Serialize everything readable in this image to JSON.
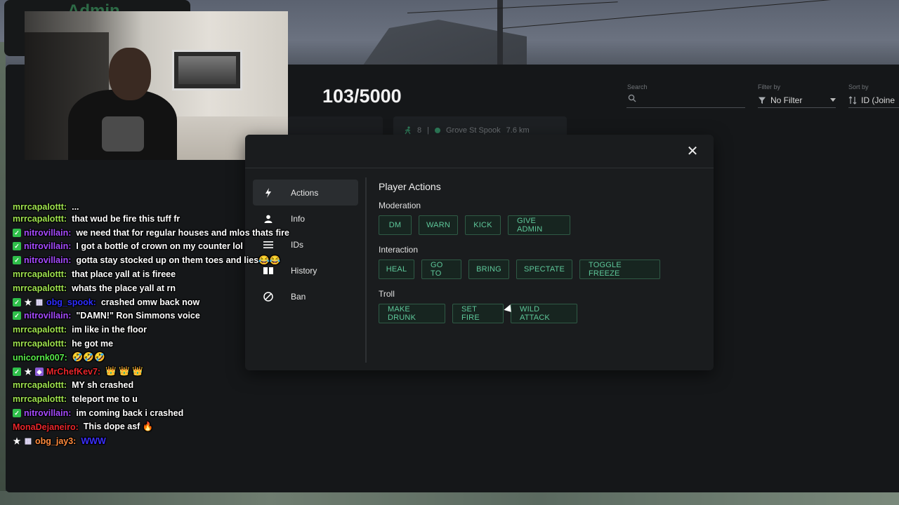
{
  "admin_tab": {
    "title": "Admin"
  },
  "header": {
    "player_count": "103/5000"
  },
  "filters": {
    "search_label": "Search",
    "search_placeholder": "",
    "filter_label": "Filter by",
    "filter_value": "No Filter",
    "sort_label": "Sort by",
    "sort_value": "ID (Joine"
  },
  "player_card": {
    "id": "8",
    "name": "Grove St Spook",
    "distance": "7.6 km"
  },
  "modal": {
    "close_label": "✕",
    "sidebar": [
      {
        "label": "Actions",
        "icon": "lightning-icon",
        "active": true
      },
      {
        "label": "Info",
        "icon": "person-icon"
      },
      {
        "label": "IDs",
        "icon": "list-icon"
      },
      {
        "label": "History",
        "icon": "book-icon"
      },
      {
        "label": "Ban",
        "icon": "ban-icon"
      }
    ],
    "title": "Player Actions",
    "sections": [
      {
        "label": "Moderation",
        "buttons": [
          "DM",
          "WARN",
          "KICK",
          "GIVE ADMIN"
        ]
      },
      {
        "label": "Interaction",
        "buttons": [
          "HEAL",
          "GO TO",
          "BRING",
          "SPECTATE",
          "TOGGLE FREEZE"
        ]
      },
      {
        "label": "Troll",
        "buttons": [
          "MAKE DRUNK",
          "SET FIRE",
          "WILD ATTACK"
        ]
      }
    ]
  },
  "chat": [
    {
      "user": "mrrcapalottt:",
      "color": "#9fe34f",
      "badges": [],
      "text": "..."
    },
    {
      "user": "mrrcapalottt:",
      "color": "#9fe34f",
      "badges": [],
      "text": "that wud be fire this tuff fr"
    },
    {
      "user": "nitrovillain:",
      "color": "#a64bff",
      "badges": [
        "check"
      ],
      "text": "we need that for regular houses and mlos thats fire"
    },
    {
      "user": "nitrovillain:",
      "color": "#a64bff",
      "badges": [
        "check"
      ],
      "text": "I got a bottle of crown on my counter lol"
    },
    {
      "user": "nitrovillain:",
      "color": "#a64bff",
      "badges": [
        "check"
      ],
      "text": "gotta stay stocked up on them toes and lies😂😂"
    },
    {
      "user": "mrrcapalottt:",
      "color": "#9fe34f",
      "badges": [],
      "text": "that place yall at is fireee"
    },
    {
      "user": "mrrcapalottt:",
      "color": "#9fe34f",
      "badges": [],
      "text": "whats the place yall at rn"
    },
    {
      "user": "obg_spook:",
      "color": "#2d2dff",
      "badges": [
        "check",
        "star",
        "gift"
      ],
      "text": "crashed omw back now"
    },
    {
      "user": "nitrovillain:",
      "color": "#a64bff",
      "badges": [
        "check"
      ],
      "text": "\"DAMN!\" Ron Simmons voice"
    },
    {
      "user": "mrrcapalottt:",
      "color": "#9fe34f",
      "badges": [],
      "text": "im like in the floor"
    },
    {
      "user": "mrrcapalottt:",
      "color": "#9fe34f",
      "badges": [],
      "text": "he got me"
    },
    {
      "user": "unicornk007:",
      "color": "#57e84a",
      "badges": [],
      "text": "🤣🤣🤣"
    },
    {
      "user": "MrChefKev7:",
      "color": "#e8262b",
      "badges": [
        "check",
        "star",
        "sub"
      ],
      "text": "👑 👑 👑"
    },
    {
      "user": "mrrcapalottt:",
      "color": "#9fe34f",
      "badges": [],
      "text": "MY sh crashed"
    },
    {
      "user": "mrrcapalottt:",
      "color": "#9fe34f",
      "badges": [],
      "text": "teleport me to u"
    },
    {
      "user": "nitrovillain:",
      "color": "#a64bff",
      "badges": [
        "check"
      ],
      "text": "im coming back i crashed"
    },
    {
      "user": "MonaDejaneiro:",
      "color": "#e8262b",
      "badges": [],
      "text": "This dope asf 🔥"
    },
    {
      "user": "obg_jay3:",
      "color": "#ff8a3d",
      "badges": [
        "star",
        "gift"
      ],
      "text": "WWW"
    }
  ],
  "colors": {
    "accent_green": "#5ec89a",
    "button_border": "#2f5a45",
    "modal_bg": "#1a1c1e",
    "panel_bg": "#151719"
  }
}
